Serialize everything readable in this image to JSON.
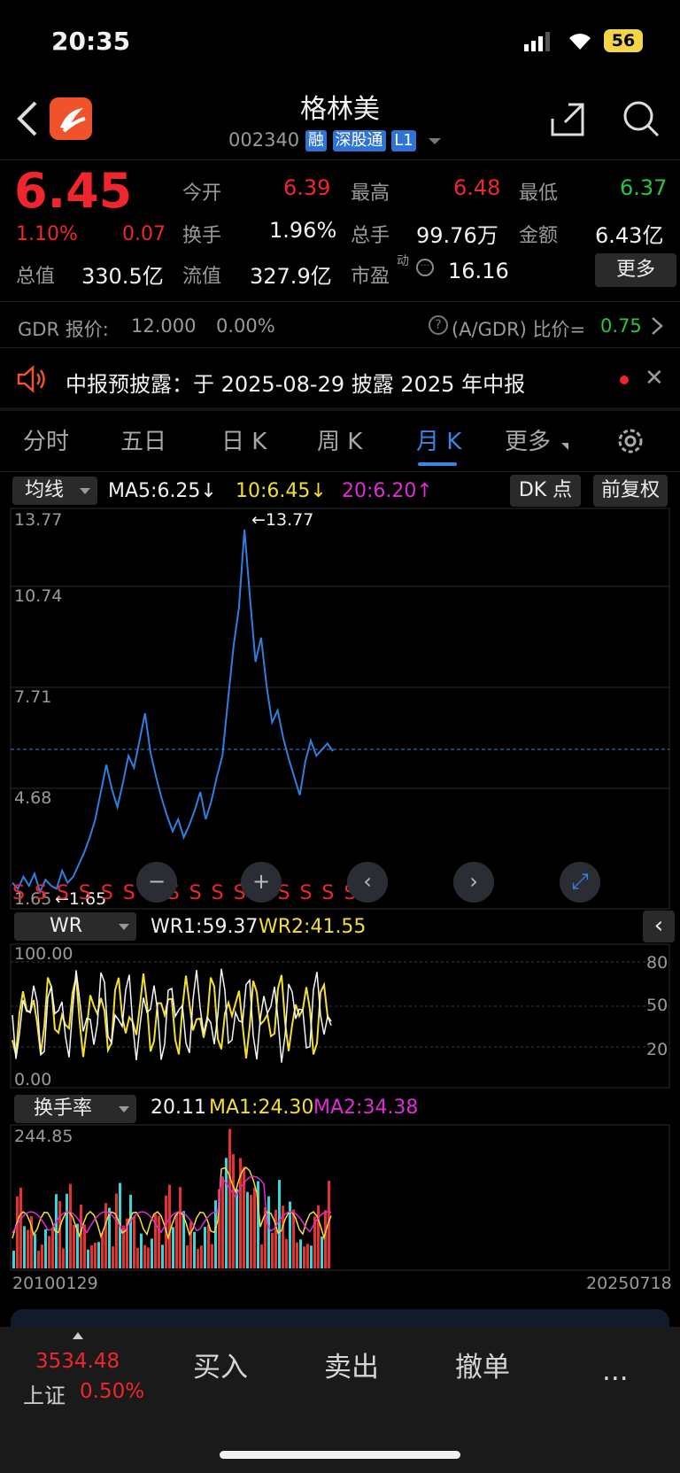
{
  "status": {
    "time": "20:35",
    "battery": "56"
  },
  "header": {
    "title": "格林美",
    "code": "002340",
    "tags": [
      "融",
      "深股通",
      "L1"
    ]
  },
  "quote": {
    "price": "6.45",
    "change_pct": "1.10%",
    "change": "0.07",
    "open_label": "今开",
    "open": "6.39",
    "high_label": "最高",
    "high": "6.48",
    "low_label": "最低",
    "low": "6.37",
    "turnover_label": "换手",
    "turnover": "1.96%",
    "volume_label": "总手",
    "volume": "99.76万",
    "amount_label": "金额",
    "amount": "6.43亿",
    "mktcap_label": "总值",
    "mktcap": "330.5亿",
    "float_label": "流值",
    "float": "327.9亿",
    "pe_label": "市盈",
    "pe_sup": "动",
    "pe": "16.16",
    "more": "更多"
  },
  "gdr": {
    "label": "GDR 报价:",
    "price": "12.000",
    "pct": "0.00%",
    "ratio_label": "(A/GDR) 比价=",
    "ratio": "0.75"
  },
  "notice": {
    "text": "中报预披露：于 2025-08-29 披露 2025 年中报"
  },
  "tabs": [
    "分时",
    "五日",
    "日 K",
    "周 K",
    "月 K",
    "更多"
  ],
  "active_tab": "月 K",
  "ma_bar": {
    "selector": "均线",
    "ma5": "MA5:6.25↓",
    "ma10": "10:6.45↓",
    "ma20": "20:6.20↑",
    "dk": "DK 点",
    "adj": "前复权"
  },
  "main_chart": {
    "y_ticks": [
      "13.77",
      "10.74",
      "7.71",
      "4.68",
      "1.65"
    ],
    "max_label": "←13.77",
    "min_label": "←1.65",
    "s_marks": "S S S S S S S S S S S S S S S S S",
    "line_color": "#2f7fe0"
  },
  "wr_bar": {
    "selector": "WR",
    "wr1": "WR1:59.37",
    "wr2": "WR2:41.55",
    "left_top": "100.00",
    "left_bottom": "0.00",
    "right_ticks": [
      "80",
      "50",
      "20"
    ]
  },
  "vol_bar": {
    "selector": "换手率",
    "val": "20.11",
    "ma1": "MA1:24.30",
    "ma2": "MA2:34.38",
    "top": "244.85",
    "date_start": "20100129",
    "date_end": "20250718"
  },
  "chart_data": [
    {
      "type": "line",
      "title": "",
      "series": [
        {
          "name": "",
          "values": [
            2.1,
            1.9,
            2.3,
            2.0,
            2.4,
            1.8,
            2.2,
            2.0,
            1.9,
            2.5,
            2.1,
            2.3,
            2.7,
            3.1,
            3.6,
            4.2,
            5.1,
            6.0,
            5.2,
            4.6,
            5.4,
            6.3,
            5.9,
            6.8,
            7.7,
            6.4,
            5.6,
            4.9,
            4.3,
            3.8,
            4.2,
            3.6,
            4.0,
            4.5,
            5.1,
            4.2,
            4.8,
            5.6,
            6.3,
            8.1,
            9.9,
            11.2,
            13.77,
            11.5,
            9.4,
            10.2,
            8.6,
            7.4,
            7.8,
            6.9,
            6.2,
            5.6,
            5.0,
            6.1,
            6.8,
            6.3,
            6.5,
            6.7,
            6.45
          ]
        }
      ],
      "ylim": [
        1.65,
        13.77
      ],
      "x_start": "20100129",
      "x_end": "20250718"
    }
  ],
  "bottom": {
    "index_value": "3534.48",
    "index_name": "上证",
    "index_pct": "0.50%",
    "buy": "买入",
    "sell": "卖出",
    "cancel": "撤单",
    "more": "..."
  }
}
